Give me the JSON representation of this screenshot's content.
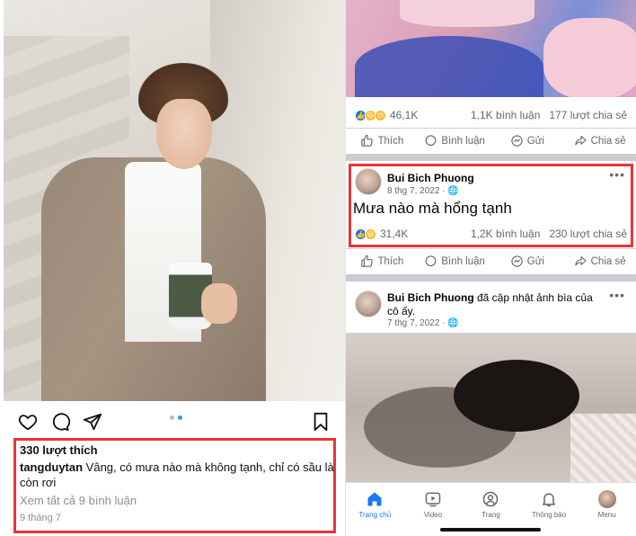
{
  "instagram": {
    "likes": "330 lượt thích",
    "username": "tangduytan",
    "caption": " Vâng, có mưa nào mà không tạnh, chỉ có sầu là còn rơi",
    "view_comments": "Xem tất cả 9 bình luận",
    "date": "9 tháng 7",
    "carousel": {
      "count": 2,
      "active": 2
    },
    "icons": [
      "heart-icon",
      "comment-icon",
      "share-icon",
      "bookmark-icon"
    ]
  },
  "facebook": {
    "top_post": {
      "reactions": "46,1K",
      "comments": "1,1K bình luận",
      "shares": "177 lượt chia sẻ"
    },
    "actions": {
      "like": "Thích",
      "comment": "Bình luận",
      "send": "Gửi",
      "share": "Chia sẻ"
    },
    "post1": {
      "author": "Bui Bich Phuong",
      "date": "8 thg 7, 2022 ·",
      "text": "Mưa nào mà hổng tạnh",
      "reactions": "31,4K",
      "comments": "1,2K bình luận",
      "shares": "230 lượt chia sẻ"
    },
    "post2": {
      "author": "Bui Bich Phuong",
      "activity": " đã cập nhật ảnh bìa của cô ấy.",
      "date": "7 thg 7, 2022 ·"
    },
    "nav": {
      "home": "Trang chủ",
      "video": "Video",
      "profile": "Trang",
      "notifications": "Thông báo",
      "menu": "Menu"
    },
    "colors": {
      "accent": "#1877f2",
      "highlight_border": "#e9343a"
    }
  }
}
